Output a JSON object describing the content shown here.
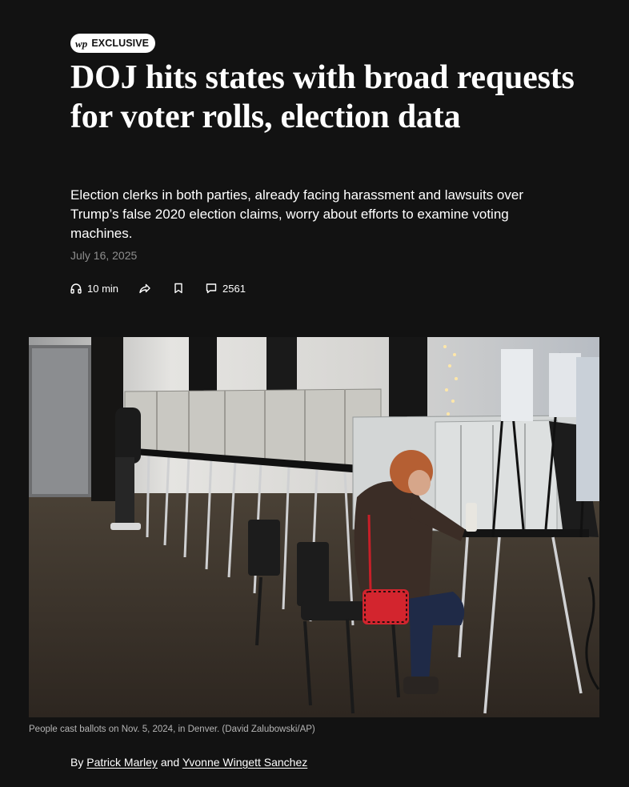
{
  "badge": {
    "logo": "wp",
    "label": "EXCLUSIVE"
  },
  "headline": "DOJ hits states with broad requests for voter rolls, election data",
  "dek": "Election clerks in both parties, already facing harassment and lawsuits over Trump’s false 2020 election claims, worry about efforts to examine voting machines.",
  "date": "July 16, 2025",
  "actions": {
    "listen": {
      "icon": "headphones-icon",
      "label": "10 min"
    },
    "share": {
      "icon": "share-icon"
    },
    "save": {
      "icon": "bookmark-icon"
    },
    "comments": {
      "icon": "comment-icon",
      "count": "2561"
    }
  },
  "photo": {
    "description_icon": "voting-booths-photo"
  },
  "caption": "People cast ballots on Nov. 5, 2024, in Denver. (David Zalubowski/AP)",
  "byline": {
    "prefix": "By",
    "author1": "Patrick Marley",
    "conjunction": "and",
    "author2": "Yvonne Wingett Sanchez"
  },
  "colors": {
    "background": "#121212",
    "text": "#ffffff",
    "muted": "#8e8e8e",
    "caption": "#b5b5b5"
  }
}
